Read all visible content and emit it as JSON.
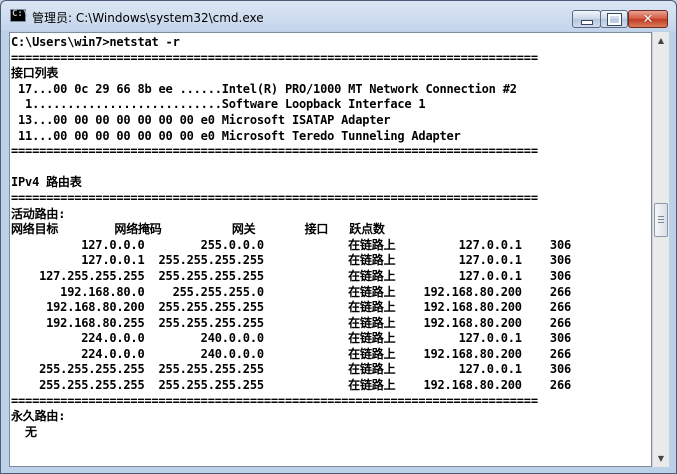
{
  "window": {
    "title": "管理员: C:\\Windows\\system32\\cmd.exe",
    "icon_text": "C:\\"
  },
  "console": {
    "lines": [
      "C:\\Users\\win7>netstat -r",
      "===========================================================================",
      "接口列表",
      " 17...00 0c 29 66 8b ee ......Intel(R) PRO/1000 MT Network Connection #2",
      "  1...........................Software Loopback Interface 1",
      " 13...00 00 00 00 00 00 00 e0 Microsoft ISATAP Adapter",
      " 11...00 00 00 00 00 00 00 e0 Microsoft Teredo Tunneling Adapter",
      "===========================================================================",
      "",
      "IPv4 路由表",
      "===========================================================================",
      "活动路由:",
      "网络目标        网络掩码          网关       接口   跃点数",
      "          127.0.0.0        255.0.0.0            在链路上         127.0.0.1    306",
      "          127.0.0.1  255.255.255.255            在链路上         127.0.0.1    306",
      "    127.255.255.255  255.255.255.255            在链路上         127.0.0.1    306",
      "       192.168.80.0    255.255.255.0            在链路上    192.168.80.200    266",
      "     192.168.80.200  255.255.255.255            在链路上    192.168.80.200    266",
      "     192.168.80.255  255.255.255.255            在链路上    192.168.80.200    266",
      "          224.0.0.0        240.0.0.0            在链路上         127.0.0.1    306",
      "          224.0.0.0        240.0.0.0            在链路上    192.168.80.200    266",
      "    255.255.255.255  255.255.255.255            在链路上         127.0.0.1    306",
      "    255.255.255.255  255.255.255.255            在链路上    192.168.80.200    266",
      "===========================================================================",
      "永久路由:",
      "  无"
    ]
  },
  "colors": {
    "console_bg": "#ffffff",
    "console_text": "#000000",
    "close_button": "#c8462e"
  }
}
